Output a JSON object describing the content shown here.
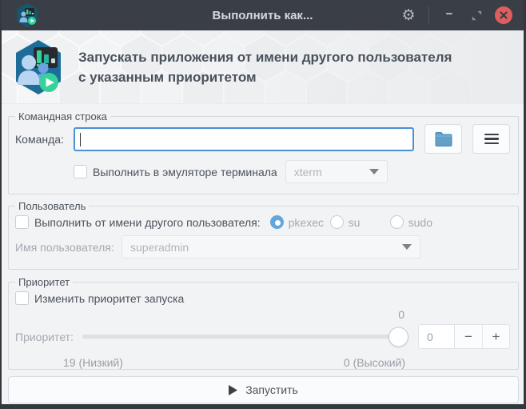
{
  "window": {
    "title": "Выполнить как...",
    "controls": {
      "minimize": "−"
    }
  },
  "header": {
    "title_line1": "Запускать приложения от имени другого пользователя",
    "title_line2": "с указанным приоритетом"
  },
  "command_group": {
    "legend": "Командная строка",
    "command_label": "Команда:",
    "command_value": "",
    "terminal_checkbox_label": "Выполнить в эмуляторе терминала",
    "terminal_checkbox_checked": false,
    "terminal_emulator_value": "xterm"
  },
  "user_group": {
    "legend": "Пользователь",
    "run_as_checkbox_label": "Выполнить от имени другого пользователя:",
    "run_as_checkbox_checked": false,
    "methods": [
      {
        "label": "pkexec",
        "selected": true
      },
      {
        "label": "su",
        "selected": false
      },
      {
        "label": "sudo",
        "selected": false
      }
    ],
    "username_label": "Имя пользователя:",
    "username_value": "superadmin"
  },
  "priority_group": {
    "legend": "Приоритет",
    "change_checkbox_label": "Изменить приоритет запуска",
    "change_checkbox_checked": false,
    "priority_label": "Приоритет:",
    "slider_value_label": "0",
    "spin_value": "0",
    "minus_label": "−",
    "plus_label": "+",
    "low_label": "19 (Низкий)",
    "high_label": "0 (Высокий)"
  },
  "run_button": {
    "label": "Запустить"
  },
  "colors": {
    "titlebar_bg": "#3a3e46",
    "accent_focus": "#4a90d9",
    "radio_selected": "#63a6dc",
    "close_button": "#df5e5e",
    "icon_hexagon": "#1d6d98",
    "play_badge": "#35d399",
    "content_bg": "#f2f3f5",
    "disabled_text": "#a4aab1"
  }
}
